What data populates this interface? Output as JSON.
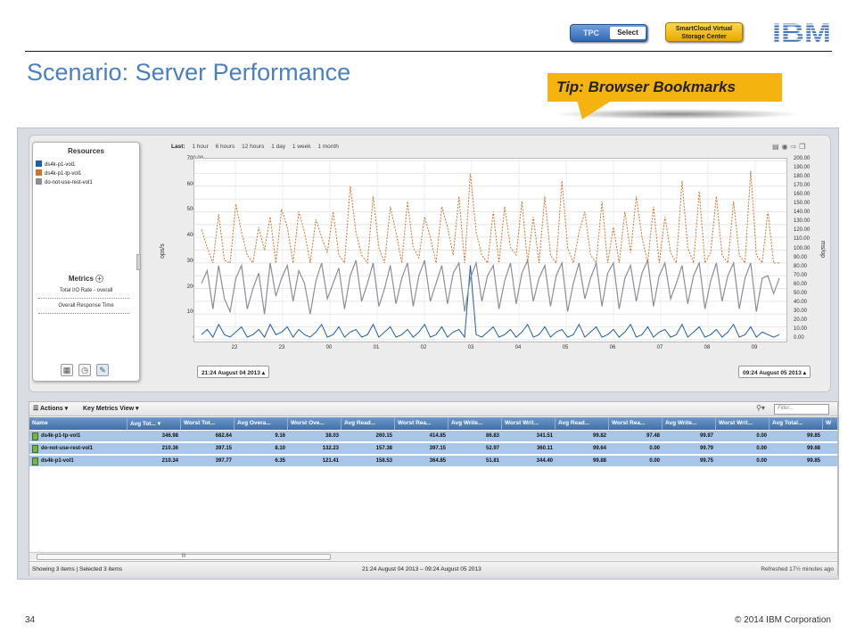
{
  "header": {
    "title": "Scenario: Server Performance",
    "tpc_left": "TPC",
    "tpc_right": "Select",
    "smartcloud_line1": "SmartCloud Virtual",
    "smartcloud_line2": "Storage Center",
    "logo": "IBM",
    "tip": "Tip: Browser Bookmarks"
  },
  "colors": {
    "title": "#4a7fc0",
    "tip_bg": "#f4b30e",
    "series_blue": "#1f5fa8",
    "series_orange": "#d0732a",
    "series_gray": "#8a8f96",
    "table_header": "#4d7db3",
    "row_selected": "#a8c6e8"
  },
  "resources": {
    "title": "Resources",
    "items": [
      {
        "label": "ds4k-p1-vol1",
        "color": "#1f5fa8"
      },
      {
        "label": "ds4k-p1-tp-vol1",
        "color": "#d0732a"
      },
      {
        "label": "do-not-use-rest-vol1",
        "color": "#8a8f96"
      }
    ]
  },
  "metrics": {
    "title": "Metrics",
    "add_icon": "plus-circle-icon",
    "items": [
      "Total I/O Rate - overall",
      "Overall Response Time"
    ]
  },
  "tools": [
    "table-icon",
    "clock-icon",
    "pin-icon"
  ],
  "timeframe": {
    "label": "Last:",
    "options": [
      "1 hour",
      "6 hours",
      "12 hours",
      "1 day",
      "1 week",
      "1 month"
    ]
  },
  "chart_tools": [
    "table-view-icon",
    "refresh-icon",
    "export-icon",
    "copy-icon"
  ],
  "chart_data": {
    "type": "line",
    "title": "",
    "xlabel": "",
    "ylabel": "ops/s",
    "y2label": "ms/op",
    "ylim": [
      0,
      700
    ],
    "y2lim": [
      0,
      200
    ],
    "x_ticks": [
      "22",
      "23",
      "00",
      "01",
      "02",
      "03",
      "04",
      "05",
      "06",
      "07",
      "08",
      "09"
    ],
    "y_ticks": [
      "700.00",
      "600.00",
      "500.00",
      "400.00",
      "300.00",
      "200.00",
      "100.00",
      "0.00"
    ],
    "y2_ticks": [
      "200.00",
      "190.00",
      "180.00",
      "170.00",
      "160.00",
      "150.00",
      "140.00",
      "130.00",
      "120.00",
      "110.00",
      "100.00",
      "90.00",
      "80.00",
      "70.00",
      "60.00",
      "50.00",
      "40.00",
      "30.00",
      "20.00",
      "10.00",
      "0.00"
    ],
    "grid": true,
    "series": [
      {
        "name": "ds4k-p1-tp-vol1",
        "color": "#d0732a",
        "values": [
          430,
          360,
          300,
          490,
          310,
          300,
          530,
          420,
          330,
          300,
          440,
          350,
          480,
          300,
          510,
          440,
          300,
          500,
          420,
          300,
          470,
          400,
          340,
          500,
          330,
          300,
          600,
          420,
          330,
          300,
          560,
          360,
          300,
          520,
          420,
          300,
          540,
          360,
          320,
          480,
          400,
          300,
          520,
          440,
          330,
          560,
          300,
          650,
          420,
          330,
          300,
          500,
          300,
          520,
          360,
          330,
          540,
          300,
          480,
          300,
          560,
          330,
          300,
          620,
          360,
          300,
          420,
          500,
          330,
          300,
          540,
          300,
          440,
          300,
          500,
          340,
          560,
          400,
          300,
          520,
          300,
          480,
          340,
          300,
          620,
          360,
          300,
          580,
          300,
          340,
          560,
          330,
          300,
          540,
          330,
          300,
          660,
          330,
          300,
          500,
          300,
          300
        ]
      },
      {
        "name": "do-not-use-rest-vol1",
        "color": "#8a8f96",
        "values": [
          220,
          270,
          120,
          290,
          160,
          110,
          240,
          290,
          120,
          200,
          260,
          100,
          300,
          170,
          240,
          290,
          150,
          270,
          220,
          100,
          230,
          300,
          160,
          220,
          280,
          120,
          250,
          310,
          150,
          220,
          300,
          130,
          200,
          290,
          140,
          240,
          300,
          130,
          250,
          310,
          150,
          220,
          290,
          140,
          260,
          300,
          110,
          240,
          300,
          150,
          250,
          290,
          120,
          230,
          300,
          140,
          260,
          310,
          150,
          240,
          290,
          130,
          250,
          300,
          110,
          220,
          300,
          160,
          240,
          300,
          130,
          260,
          300,
          120,
          240,
          290,
          150,
          260,
          310,
          130,
          250,
          300,
          160,
          220,
          290,
          140,
          250,
          300,
          120,
          230,
          300,
          150,
          250,
          300,
          120,
          240,
          300,
          110,
          240,
          250,
          180,
          240
        ]
      },
      {
        "name": "ds4k-p1-vol1",
        "color": "#1f5fa8",
        "values": [
          20,
          40,
          10,
          60,
          20,
          10,
          30,
          50,
          10,
          20,
          40,
          10,
          60,
          20,
          30,
          50,
          10,
          40,
          20,
          10,
          30,
          60,
          10,
          20,
          50,
          10,
          30,
          40,
          10,
          20,
          60,
          10,
          30,
          50,
          10,
          20,
          40,
          10,
          30,
          60,
          10,
          20,
          50,
          10,
          30,
          40,
          10,
          290,
          20,
          10,
          30,
          50,
          10,
          20,
          40,
          10,
          30,
          60,
          10,
          20,
          50,
          10,
          30,
          40,
          10,
          20,
          60,
          10,
          30,
          50,
          10,
          20,
          40,
          10,
          30,
          60,
          10,
          20,
          50,
          10,
          30,
          40,
          10,
          20,
          60,
          10,
          30,
          50,
          10,
          20,
          40,
          10,
          30,
          60,
          10,
          20,
          50,
          10,
          30,
          20,
          10,
          20
        ]
      }
    ]
  },
  "date_range": {
    "start": "21:24 August 04 2013",
    "end": "09:24 August 05 2013"
  },
  "table": {
    "actions_label": "Actions",
    "view_label": "Key Metrics View",
    "filter_placeholder": "Filter...",
    "columns": [
      "Name",
      "Avg Tot...",
      "Worst Tot...",
      "Avg Overa...",
      "Worst Ove...",
      "Avg Read...",
      "Worst Rea...",
      "Avg Write...",
      "Worst Writ...",
      "Avg Read...",
      "Worst Rea...",
      "Avg Write...",
      "Worst Writ...",
      "Avg Total...",
      "W"
    ],
    "rows": [
      [
        "ds4k-p1-tp-vol1",
        "346.98",
        "682.64",
        "9.16",
        "38.03",
        "260.15",
        "414.85",
        "86.83",
        "341.51",
        "99.82",
        "97.48",
        "99.97",
        "0.00",
        "99.85",
        ""
      ],
      [
        "do-not-use-rest-vol1",
        "210.36",
        "397.15",
        "8.10",
        "132.23",
        "157.38",
        "397.15",
        "52.97",
        "360.11",
        "99.64",
        "0.00",
        "99.79",
        "0.00",
        "99.68",
        ""
      ],
      [
        "ds4k-p1-vol1",
        "210.34",
        "397.77",
        "6.35",
        "121.41",
        "158.53",
        "364.85",
        "51.81",
        "344.40",
        "99.88",
        "0.00",
        "99.75",
        "0.00",
        "99.85",
        ""
      ]
    ],
    "scroll_thumb_label": "III",
    "status_left": "Showing 3 items | Selected 3 items",
    "status_center": "21:24 August 04 2013 – 09:24 August 05 2013",
    "status_right": "Refreshed 17½ minutes ago"
  },
  "footer": {
    "page": "34",
    "copyright": "© 2014 IBM Corporation"
  }
}
